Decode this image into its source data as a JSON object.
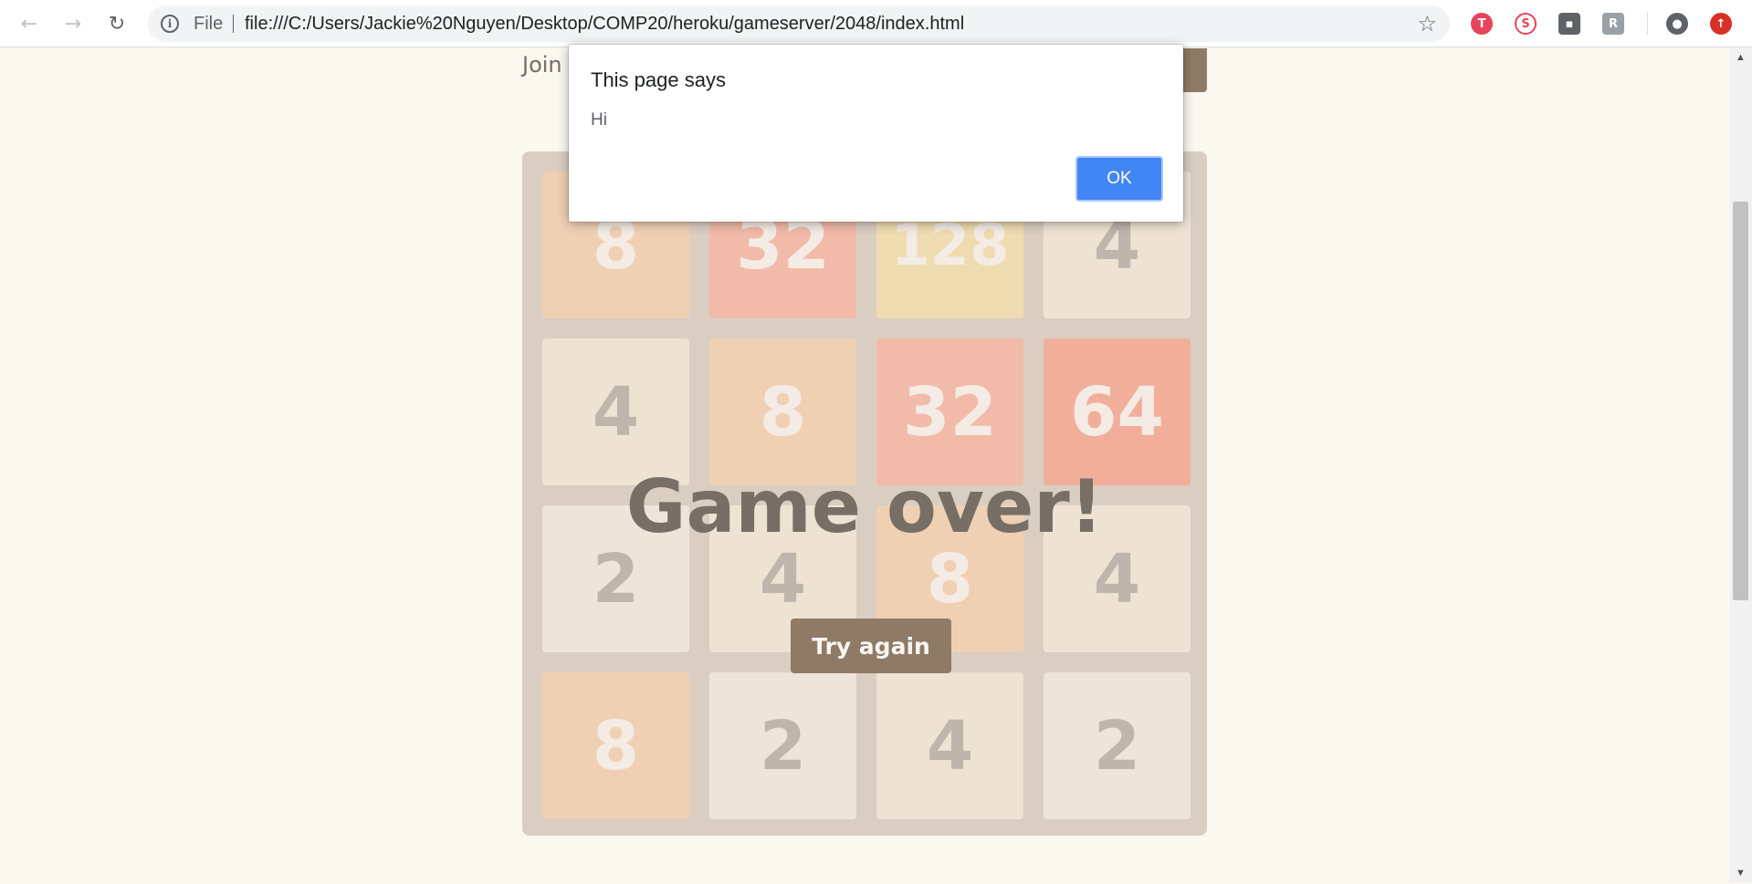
{
  "browser": {
    "scheme_label": "File",
    "url": "file:///C:/Users/Jackie%20Nguyen/Desktop/COMP20/heroku/gameserver/2048/index.html",
    "icons": {
      "back": "arrow-left-icon",
      "forward": "arrow-right-icon",
      "reload": "reload-icon",
      "info": "info-icon",
      "bookmark": "star-icon",
      "profile": "account-icon"
    },
    "extensions": [
      {
        "name": "extension-red-icon",
        "glyph": "T",
        "color": "#e8435a"
      },
      {
        "name": "extension-no-sign-icon",
        "glyph": "S",
        "color": "#e8435a"
      },
      {
        "name": "extension-face-icon",
        "glyph": "☐",
        "color": "#5f6368"
      },
      {
        "name": "extension-grey-icon",
        "glyph": "R",
        "color": "#9aa0a6"
      },
      {
        "name": "extension-update-icon",
        "glyph": "↑",
        "color": "#d93025"
      }
    ]
  },
  "page": {
    "intro_text": "Join"
  },
  "game": {
    "tiles": [
      [
        8,
        32,
        128,
        4
      ],
      [
        4,
        8,
        32,
        64
      ],
      [
        2,
        4,
        8,
        4
      ],
      [
        8,
        2,
        4,
        2
      ]
    ],
    "tile_colors": {
      "2": {
        "bg": "#eee4da",
        "fg": "#776e65"
      },
      "4": {
        "bg": "#ede0c8",
        "fg": "#776e65"
      },
      "8": {
        "bg": "#f2b179",
        "fg": "#f9f6f2"
      },
      "32": {
        "bg": "#f67c5f",
        "fg": "#f9f6f2"
      },
      "64": {
        "bg": "#f65e3b",
        "fg": "#f9f6f2"
      },
      "128": {
        "bg": "#edcf72",
        "fg": "#f9f6f2"
      }
    },
    "message": "Game over!",
    "retry_label": "Try again"
  },
  "dialog": {
    "title": "This page says",
    "message": "Hi",
    "ok_label": "OK"
  }
}
